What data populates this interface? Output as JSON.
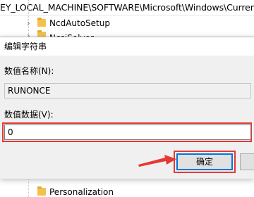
{
  "registry": {
    "path": "EY_LOCAL_MACHINE\\SOFTWARE\\Microsoft\\Windows\\CurrentVe",
    "tree_items": [
      {
        "label": "NcdAutoSetup"
      },
      {
        "label": "NcsiSolver"
      },
      {
        "label": "Personalization"
      }
    ]
  },
  "dialog": {
    "title": "编辑字符串",
    "value_name_label": "数值名称(N):",
    "value_name": "RUNONCE",
    "value_data_label": "数值数据(V):",
    "value_data": "0",
    "ok_label": "确定"
  },
  "colors": {
    "highlight": "#e53935",
    "focus": "#0078d7",
    "folder": "#f2c14e"
  }
}
